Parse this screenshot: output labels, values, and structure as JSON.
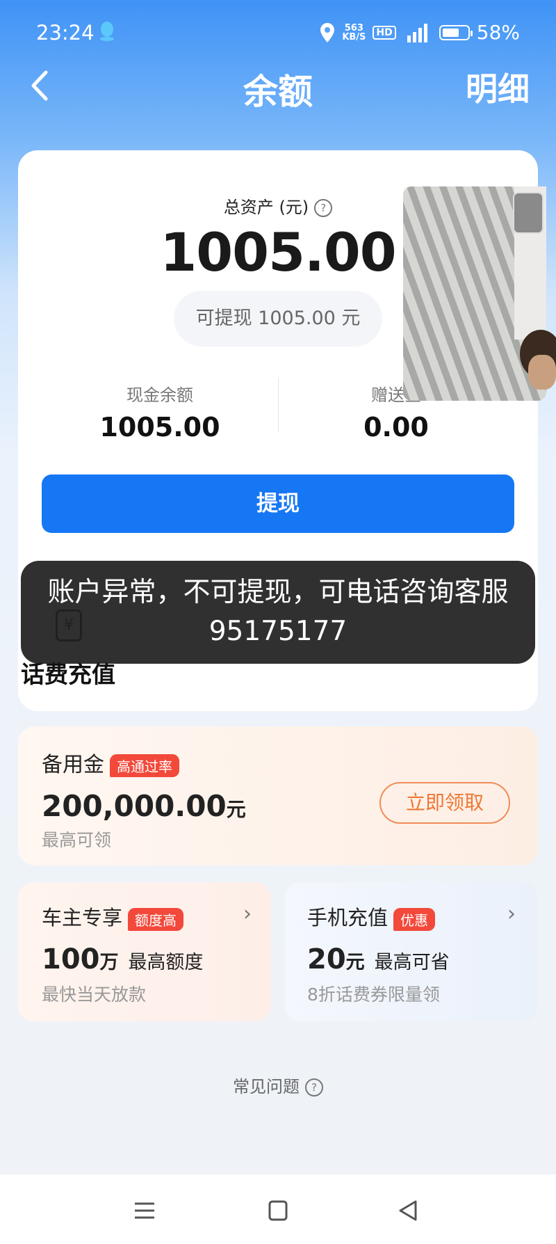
{
  "status": {
    "time": "23:24",
    "speed_top": "563",
    "speed_bottom": "KB/S",
    "hd": "HD",
    "battery": "58%"
  },
  "header": {
    "title": "余额",
    "detail": "明细"
  },
  "balance": {
    "total_label": "总资产 (元)",
    "total_value": "1005.00",
    "withdrawable": "可提现 1005.00 元",
    "cash_label": "现金余额",
    "cash_value": "1005.00",
    "gift_label": "赠送金",
    "gift_value": "0.00",
    "withdraw_button": "提现"
  },
  "toast": "账户异常，不可提现，可电话咨询客服95175177",
  "services": {
    "phone_charge_label": "话费充值"
  },
  "backup_fund": {
    "title": "备用金",
    "tag": "高通过率",
    "amount": "200,000.00",
    "unit": "元",
    "sub": "最高可领",
    "button": "立即领取"
  },
  "car_card": {
    "title": "车主专享",
    "tag": "额度高",
    "amount": "100",
    "unit": "万",
    "desc": "最高额度",
    "sub": "最快当天放款"
  },
  "phone_card": {
    "title": "手机充值",
    "tag": "优惠",
    "amount": "20",
    "unit": "元",
    "desc": "最高可省",
    "sub": "8折话费券限量领"
  },
  "faq": "常见问题",
  "colors": {
    "primary": "#1677f5",
    "accent_orange": "#ee7733",
    "tag_red": "#f2493b"
  }
}
